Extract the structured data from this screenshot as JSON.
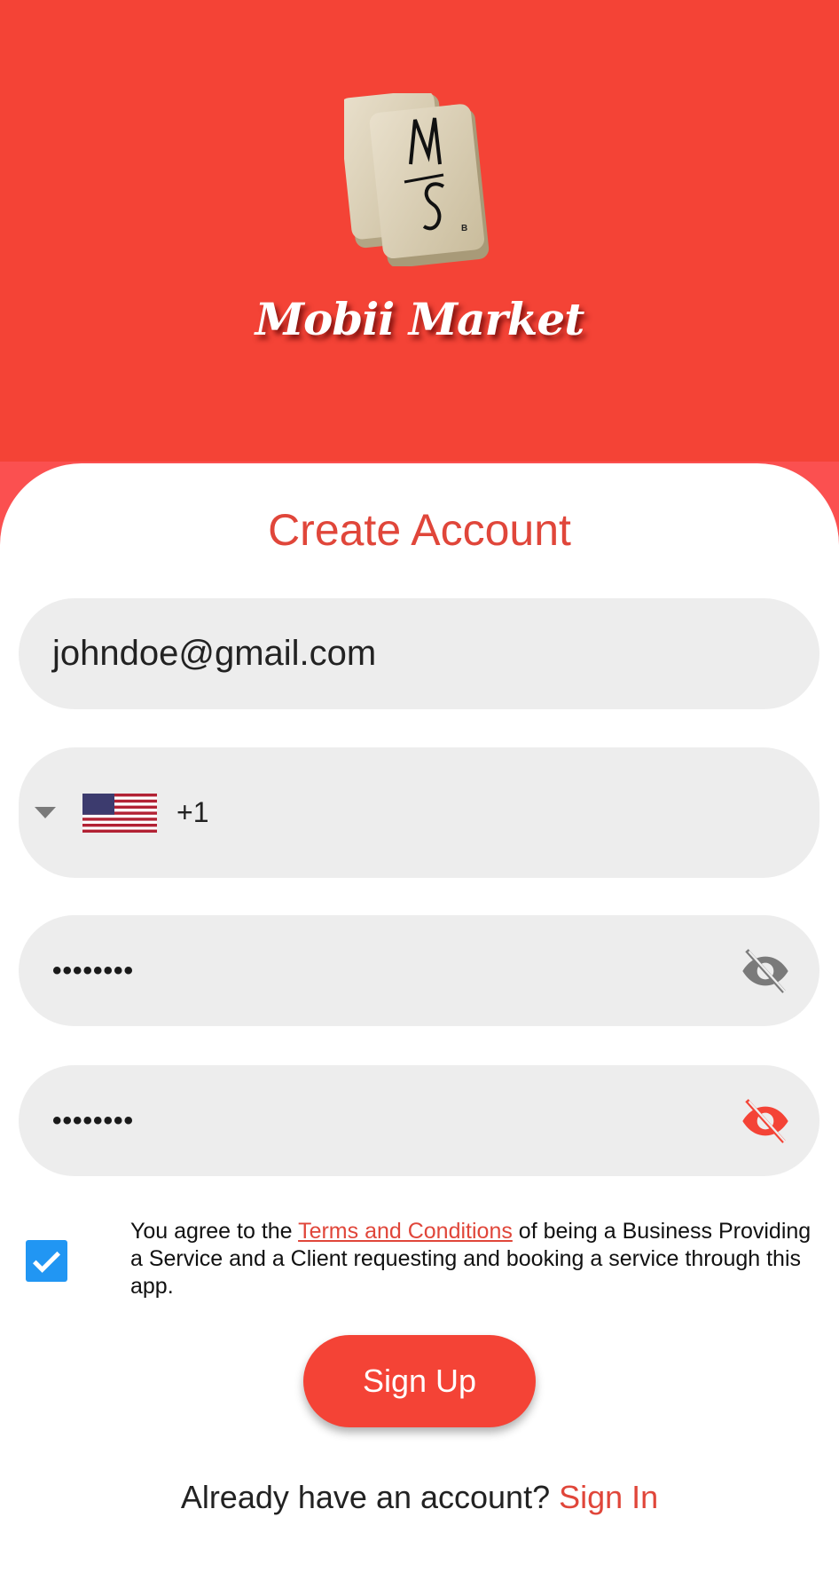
{
  "app": {
    "brand_name": "Mobii Market",
    "logo_letters": "MS",
    "accent_color": "#f44336"
  },
  "form": {
    "title": "Create Account",
    "email": {
      "value": "johndoe@gmail.com"
    },
    "phone": {
      "country_flag": "us-flag-icon",
      "dial_code": "+1",
      "value": ""
    },
    "password": {
      "value": "••••••••",
      "toggle_icon": "eye-off-icon"
    },
    "confirm_password": {
      "value": "••••••••",
      "toggle_icon": "eye-off-icon"
    },
    "terms": {
      "checked": true,
      "prefix": "You agree to the ",
      "link": "Terms and Conditions",
      "suffix": " of being a Business Providing a Service and a Client requesting and booking a service through this app."
    },
    "submit_label": "Sign Up",
    "signin_prompt": "Already have an account? ",
    "signin_link": "Sign In"
  }
}
